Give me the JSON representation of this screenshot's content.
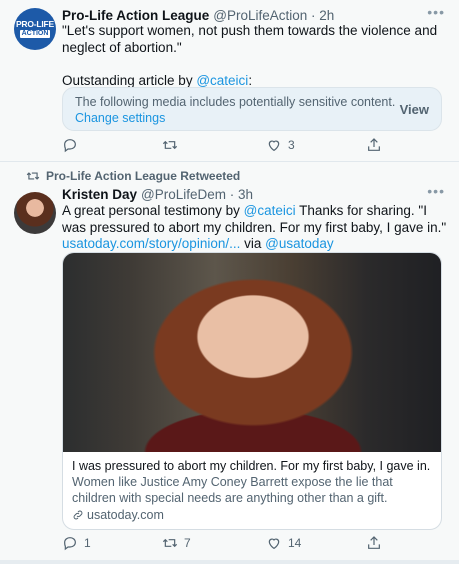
{
  "tweet1": {
    "avatar_logo_top": "PRO-LIFE",
    "avatar_logo_bottom": "ACTION",
    "name": "Pro-Life Action League",
    "handle": "@ProLifeAction · 2h",
    "text_line": "\"Let's support women, not push them towards the violence and neglect of abortion.\"",
    "outstanding_prefix": "Outstanding article by ",
    "outstanding_mention": "@cateici",
    "outstanding_suffix": ":",
    "sensitive_notice": "The following media includes potentially sensitive content.",
    "change_settings": "Change settings",
    "view_label": "View",
    "reply_count": "",
    "retweet_count": "",
    "like_count": "3"
  },
  "tweet2": {
    "retweet_label": "Pro-Life Action League Retweeted",
    "name": "Kristen Day",
    "handle": "@ProLifeDem · 3h",
    "text_prefix": "A great personal testimony by ",
    "text_mention": "@cateici",
    "text_rest": " Thanks for sharing. \"I was pressured to abort my children. For my first baby, I gave in.\"",
    "url_text": "usatoday.com/story/opinion/...",
    "via_text": " via ",
    "via_mention": "@usatoday",
    "card_title": "I was pressured to abort my children. For my first baby, I gave in.",
    "card_description": "Women like Justice Amy Coney Barrett expose the lie that children with special needs are anything other than a gift.",
    "card_domain": "usatoday.com",
    "reply_count": "1",
    "retweet_count": "7",
    "like_count": "14"
  },
  "icons": [
    "more-icon",
    "reply-icon",
    "retweet-icon",
    "like-icon",
    "share-icon",
    "link-icon"
  ],
  "colors": {
    "link": "#1b95e0",
    "muted": "#536471",
    "brand": "#1d5aa8"
  }
}
